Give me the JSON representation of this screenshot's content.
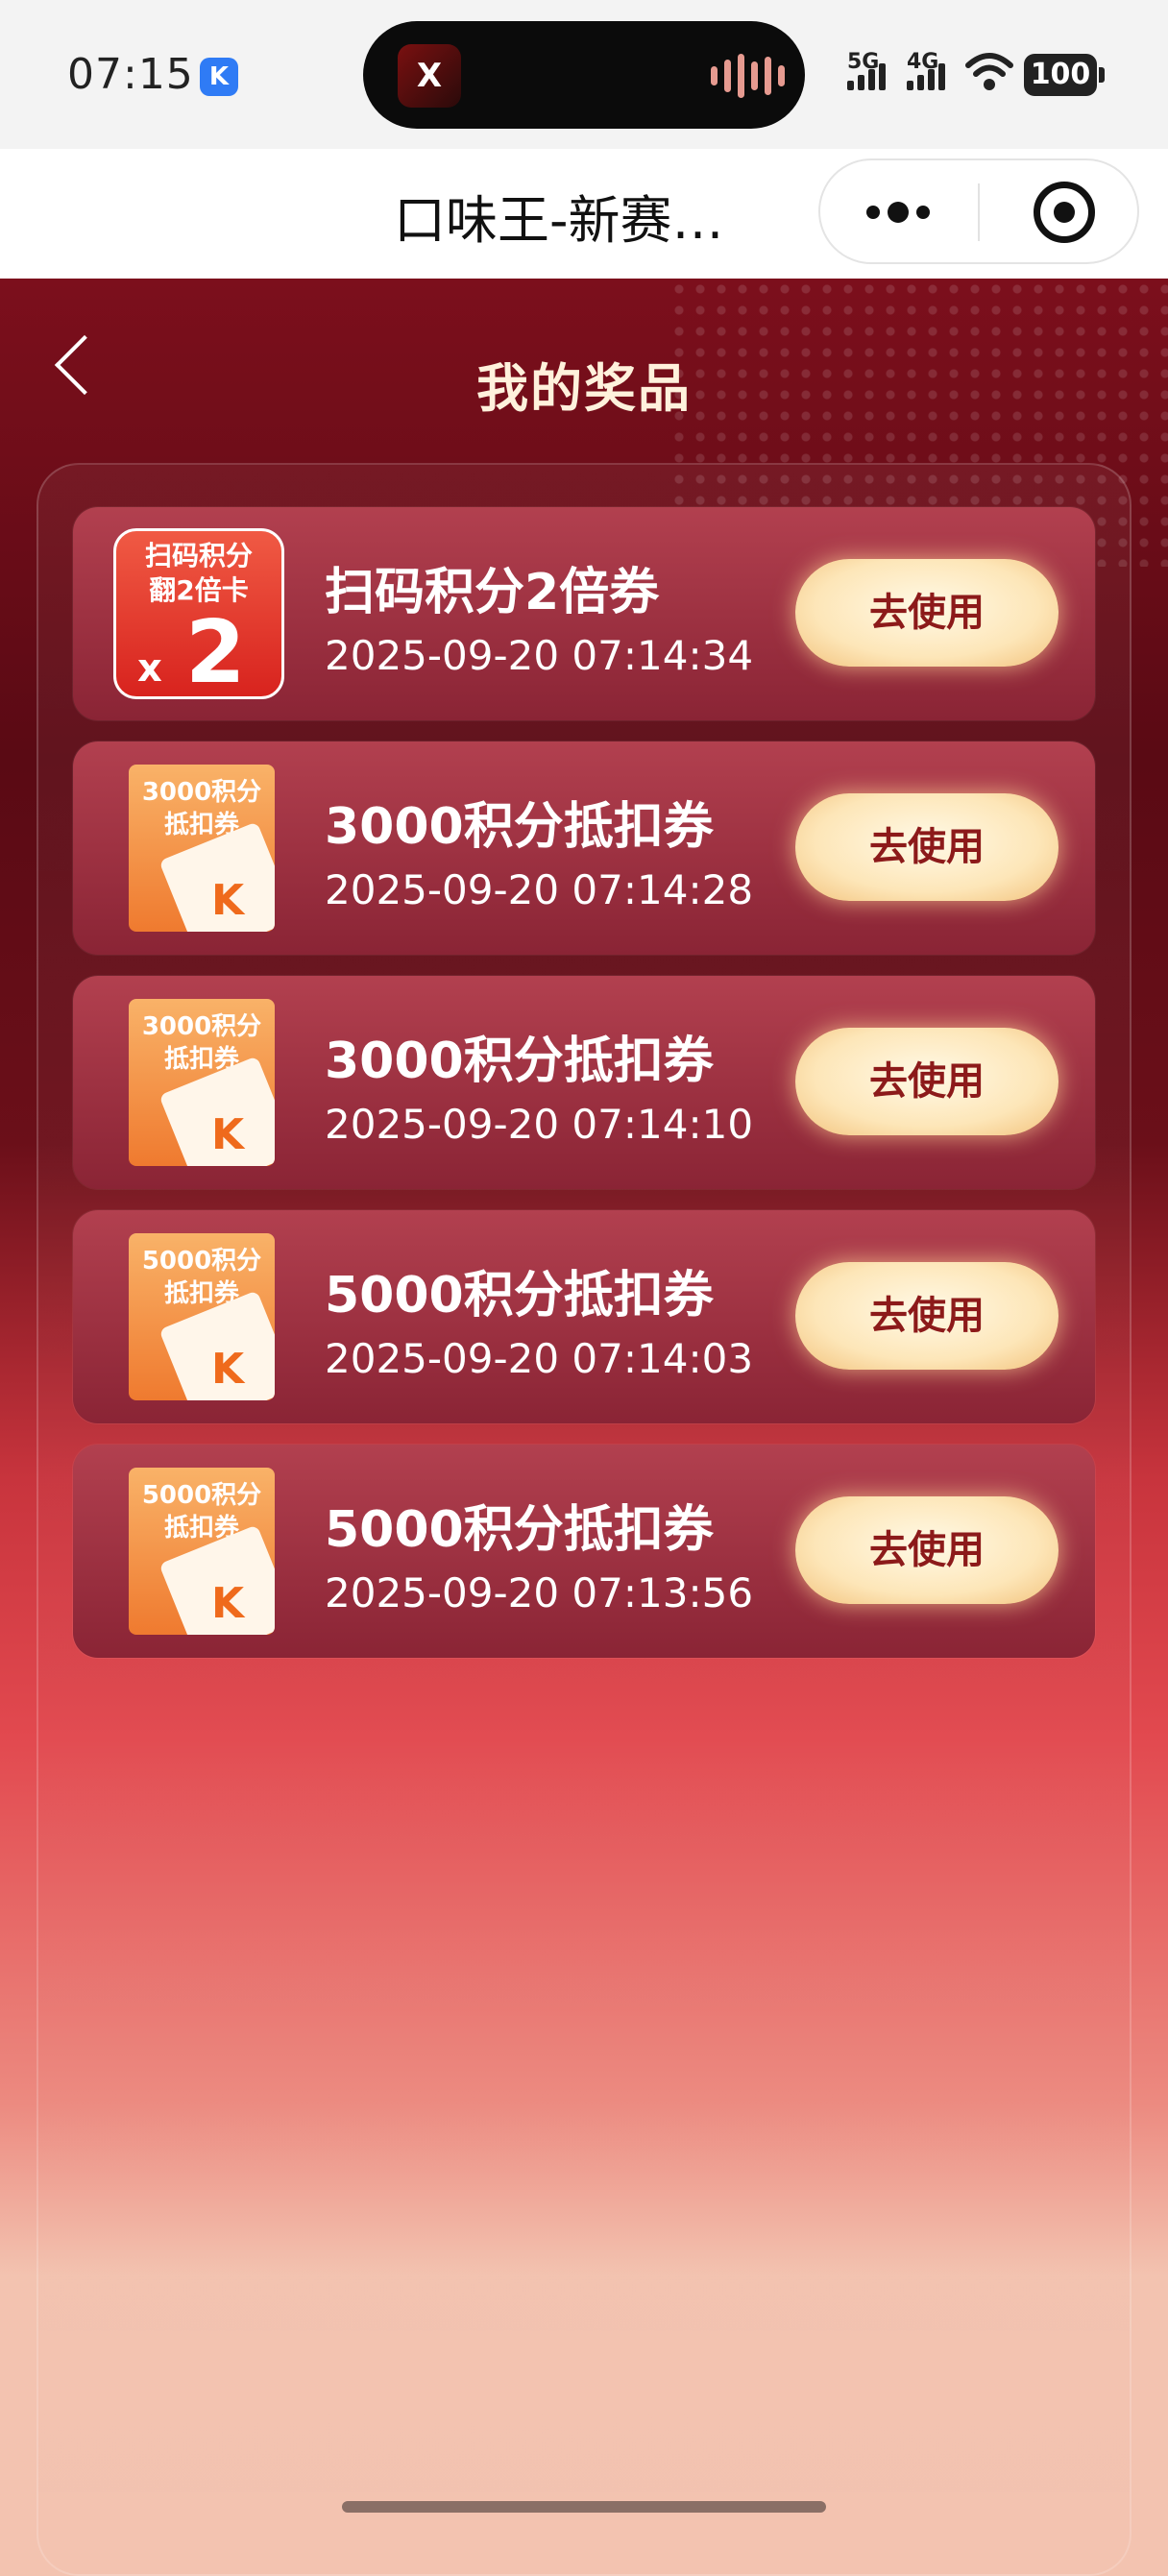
{
  "status_bar": {
    "time": "07:15",
    "battery": "100",
    "sig1": "5G",
    "sig2": "4G"
  },
  "nav": {
    "title": "口味王-新赛…"
  },
  "page": {
    "title": "我的奖品"
  },
  "prizes": [
    {
      "name": "扫码积分2倍券",
      "date": "2025-09-20 07:14:34",
      "thumb_line1": "扫码积分",
      "thumb_line2": "翻2倍卡",
      "btn": "去使用"
    },
    {
      "name": "3000积分抵扣券",
      "date": "2025-09-20 07:14:28",
      "thumb_line1": "3000积分",
      "thumb_line2": "抵扣券",
      "btn": "去使用"
    },
    {
      "name": "3000积分抵扣券",
      "date": "2025-09-20 07:14:10",
      "thumb_line1": "3000积分",
      "thumb_line2": "抵扣券",
      "btn": "去使用"
    },
    {
      "name": "5000积分抵扣券",
      "date": "2025-09-20 07:14:03",
      "thumb_line1": "5000积分",
      "thumb_line2": "抵扣券",
      "btn": "去使用"
    },
    {
      "name": "5000积分抵扣券",
      "date": "2025-09-20 07:13:56",
      "thumb_line1": "5000积分",
      "thumb_line2": "抵扣券",
      "btn": "去使用"
    }
  ]
}
